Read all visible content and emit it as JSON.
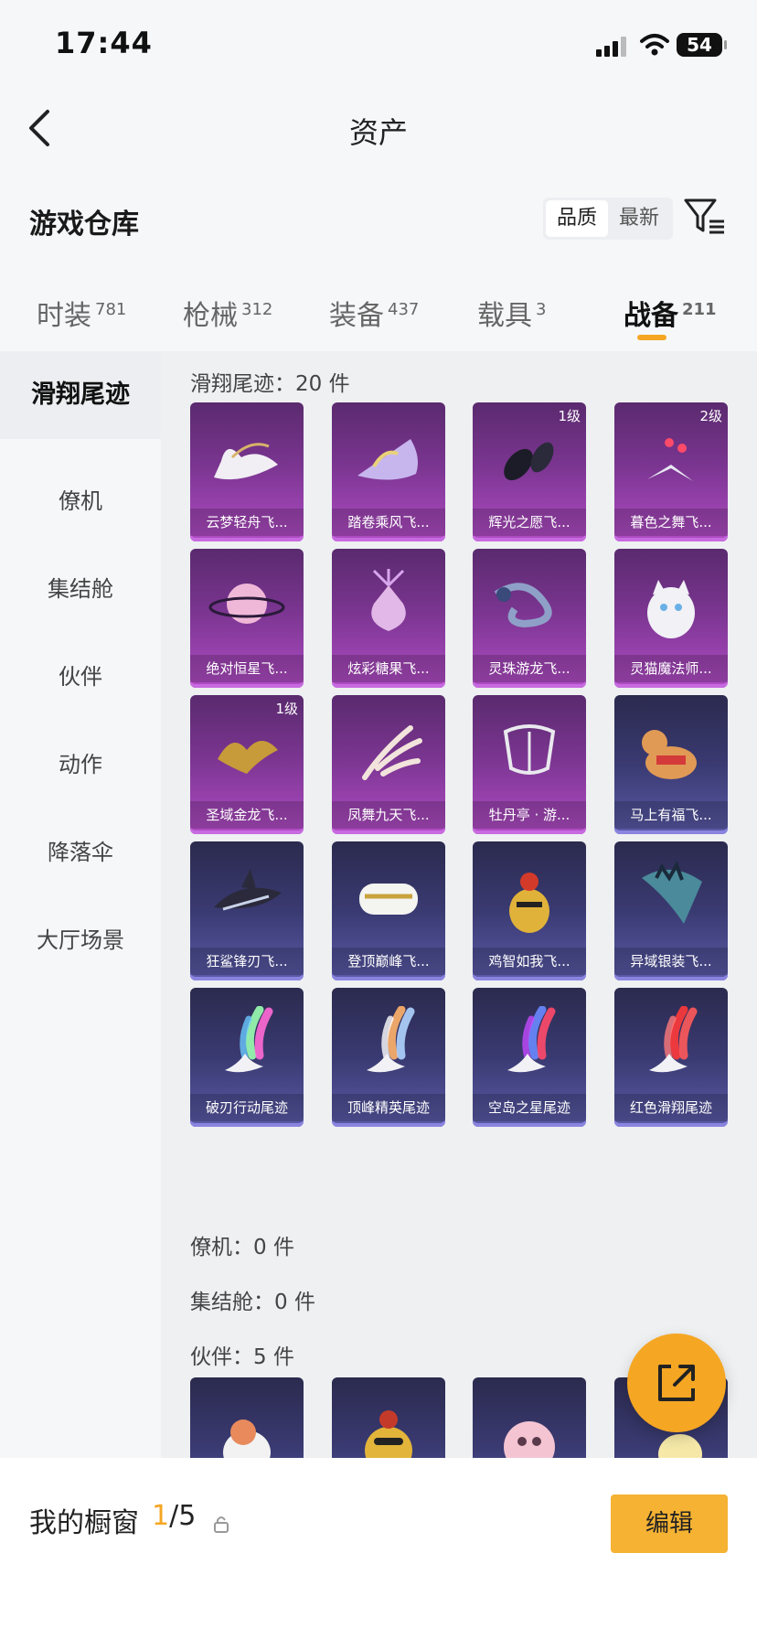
{
  "status_bar": {
    "time": "17:44",
    "battery": "54"
  },
  "nav": {
    "title": "资产"
  },
  "header": {
    "title": "游戏仓库",
    "sort_options": [
      "品质",
      "最新"
    ]
  },
  "tabs": [
    {
      "label": "时装",
      "count": "781"
    },
    {
      "label": "枪械",
      "count": "312"
    },
    {
      "label": "装备",
      "count": "437"
    },
    {
      "label": "载具",
      "count": "3"
    },
    {
      "label": "战备",
      "count": "211"
    }
  ],
  "sidebar": {
    "items": [
      "滑翔尾迹",
      "僚机",
      "集结舱",
      "伙伴",
      "动作",
      "降落伞",
      "大厅场景"
    ]
  },
  "sections": {
    "glide": {
      "heading": "滑翔尾迹：20 件",
      "items": [
        {
          "name": "云梦轻舟飞...",
          "level": "",
          "rarity": "purple"
        },
        {
          "name": "踏卷乘风飞...",
          "level": "",
          "rarity": "purple"
        },
        {
          "name": "辉光之愿飞...",
          "level": "1级",
          "rarity": "purple"
        },
        {
          "name": "暮色之舞飞...",
          "level": "2级",
          "rarity": "purple"
        },
        {
          "name": "绝对恒星飞...",
          "level": "",
          "rarity": "purple"
        },
        {
          "name": "炫彩糖果飞...",
          "level": "",
          "rarity": "purple"
        },
        {
          "name": "灵珠游龙飞...",
          "level": "",
          "rarity": "purple"
        },
        {
          "name": "灵猫魔法师...",
          "level": "",
          "rarity": "purple"
        },
        {
          "name": "圣域金龙飞...",
          "level": "1级",
          "rarity": "purple"
        },
        {
          "name": "凤舞九天飞...",
          "level": "",
          "rarity": "purple"
        },
        {
          "name": "牡丹亭 · 游...",
          "level": "",
          "rarity": "purple"
        },
        {
          "name": "马上有福飞...",
          "level": "",
          "rarity": "blue"
        },
        {
          "name": "狂鲨锋刃飞...",
          "level": "",
          "rarity": "blue"
        },
        {
          "name": "登顶巅峰飞...",
          "level": "",
          "rarity": "blue"
        },
        {
          "name": "鸡智如我飞...",
          "level": "",
          "rarity": "blue"
        },
        {
          "name": "异域银装飞...",
          "level": "",
          "rarity": "blue"
        },
        {
          "name": "破刃行动尾迹",
          "level": "",
          "rarity": "blue"
        },
        {
          "name": "顶峰精英尾迹",
          "level": "",
          "rarity": "blue"
        },
        {
          "name": "空岛之星尾迹",
          "level": "",
          "rarity": "blue"
        },
        {
          "name": "红色滑翔尾迹",
          "level": "",
          "rarity": "blue"
        }
      ]
    },
    "wingman": {
      "heading": "僚机：0 件"
    },
    "capsule": {
      "heading": "集结舱：0 件"
    },
    "partner": {
      "heading": "伙伴：5 件"
    }
  },
  "bottom": {
    "showcase_label": "我的橱窗",
    "showcase_current": "1",
    "showcase_total": "/5",
    "edit_label": "编辑"
  },
  "colors": {
    "accent": "#f5a623",
    "purple_card": "#7a3590",
    "blue_card": "#3a3a72"
  }
}
